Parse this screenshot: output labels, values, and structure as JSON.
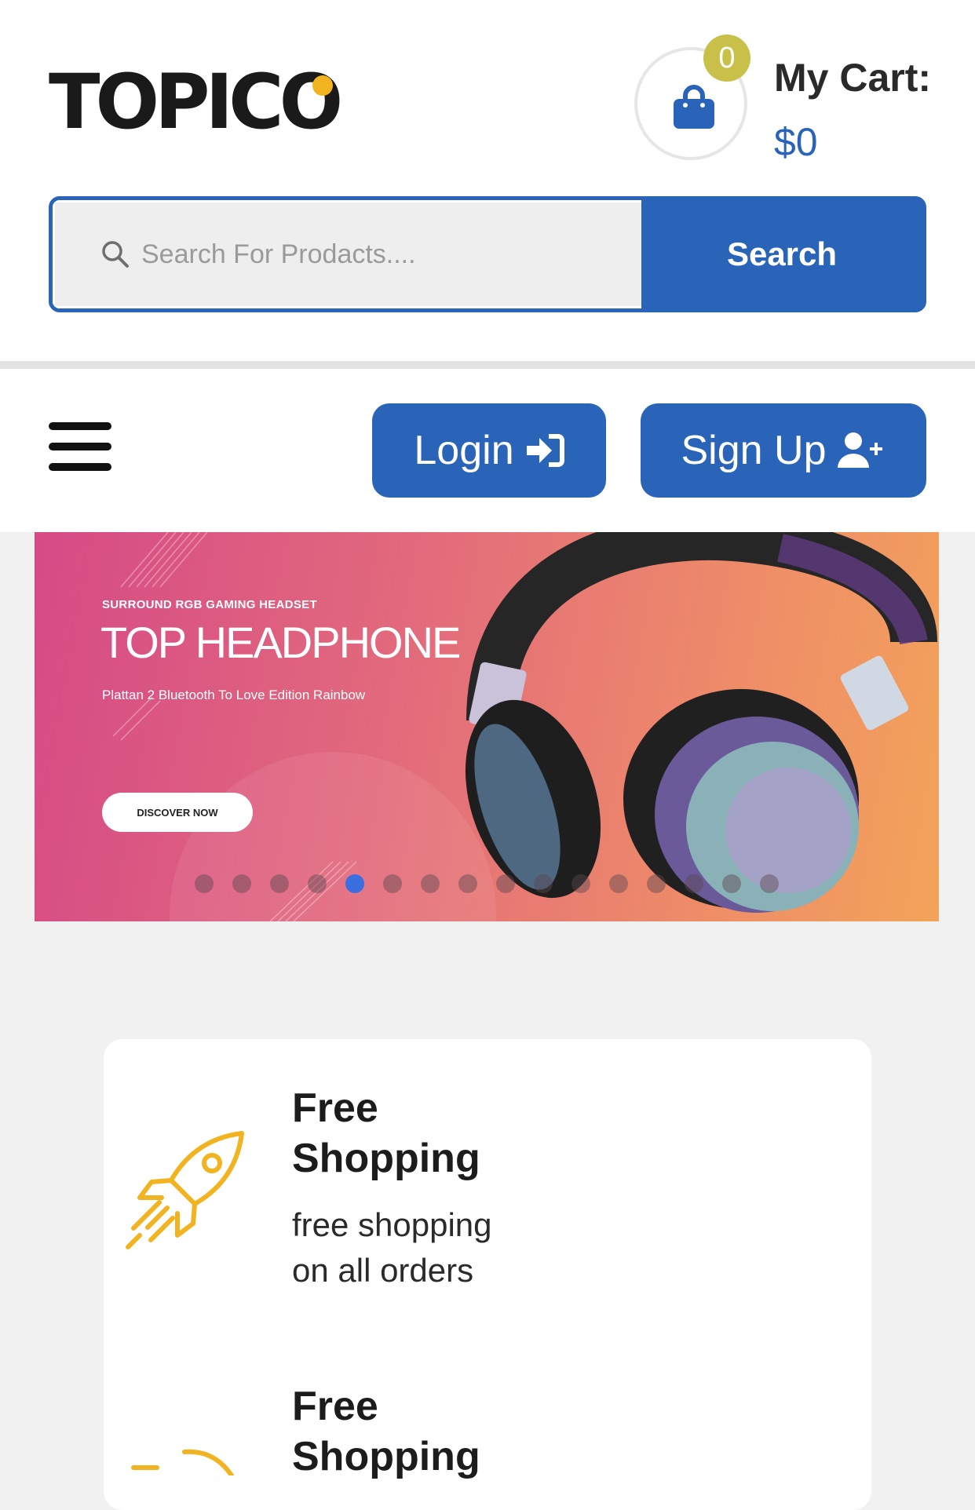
{
  "header": {
    "logo_text": "TOPICO",
    "cart_count": "0",
    "cart_title": "My Cart:",
    "cart_amount": "$0",
    "search": {
      "placeholder": "Search For Prodacts....",
      "button_label": "Search"
    }
  },
  "nav": {
    "login_label": "Login",
    "signup_label": "Sign Up"
  },
  "banner": {
    "subtitle": "SURROUND RGB GAMING HEADSET",
    "title": "TOP HEADPHONE",
    "description": "Plattan 2 Bluetooth To Love Edition Rainbow",
    "cta_label": "DISCOVER NOW",
    "slide_count": 16,
    "active_slide": 5
  },
  "features": [
    {
      "title_line1": "Free",
      "title_line2": "Shopping",
      "desc_line1": "free shopping",
      "desc_line2": "on all orders",
      "icon": "rocket-icon"
    },
    {
      "title_line1": "Free",
      "title_line2": "Shopping",
      "icon": "feature-icon"
    }
  ],
  "colors": {
    "primary": "#2a64b8",
    "badge": "#c9c04a",
    "icon_accent": "#f2b320",
    "logo_dot": "#f2b320"
  }
}
